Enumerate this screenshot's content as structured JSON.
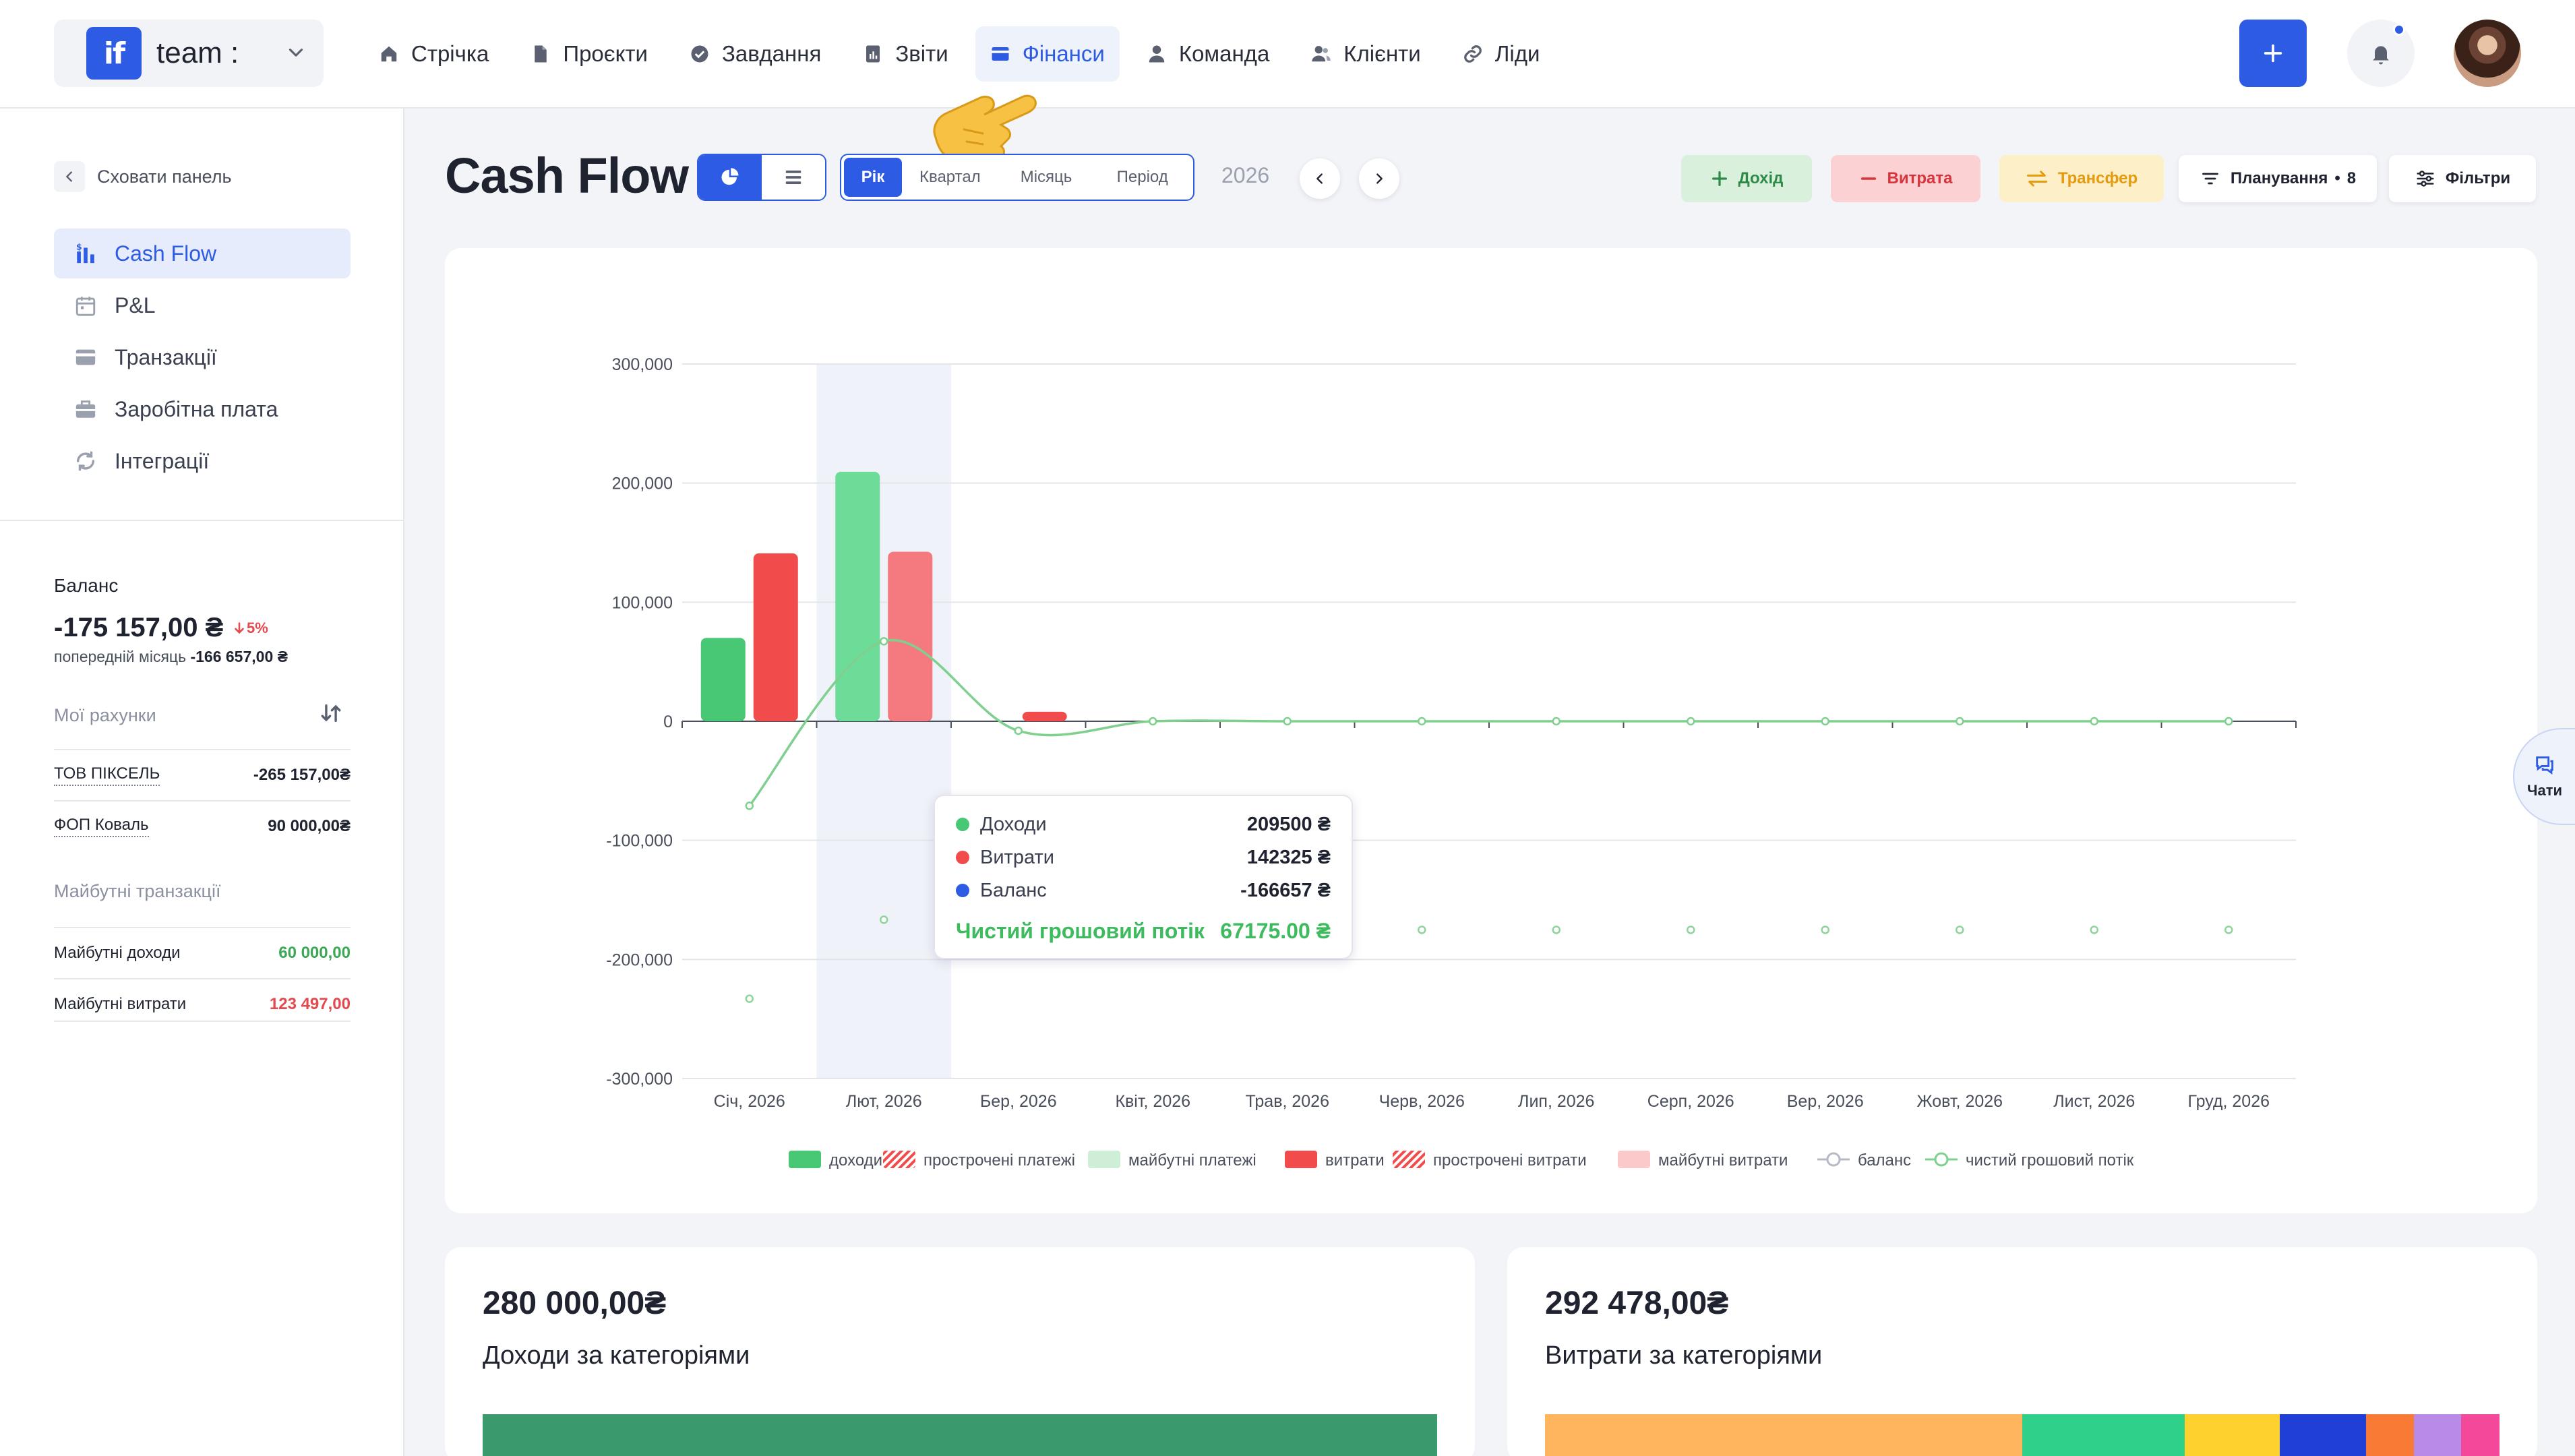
{
  "brand": {
    "logo": "if",
    "name": "team :"
  },
  "nav": [
    {
      "label": "Стрічка",
      "icon": "home-icon"
    },
    {
      "label": "Проєкти",
      "icon": "file-icon"
    },
    {
      "label": "Завдання",
      "icon": "check-circle-icon"
    },
    {
      "label": "Звіти",
      "icon": "report-icon"
    },
    {
      "label": "Фінанси",
      "icon": "wallet-icon",
      "active": true
    },
    {
      "label": "Команда",
      "icon": "user-icon"
    },
    {
      "label": "Клієнти",
      "icon": "users-icon"
    },
    {
      "label": "Ліди",
      "icon": "link-icon"
    }
  ],
  "sidebar": {
    "hide_label": "Сховати панель",
    "menu": [
      {
        "label": "Cash Flow",
        "icon": "bar-dollar-icon",
        "active": true
      },
      {
        "label": "P&L",
        "icon": "calendar-icon"
      },
      {
        "label": "Транзакції",
        "icon": "card-icon"
      },
      {
        "label": "Заробітна плата",
        "icon": "briefcase-icon"
      },
      {
        "label": "Інтеграції",
        "icon": "refresh-icon"
      }
    ],
    "balance": {
      "title": "Баланс",
      "value": "-175 157,00 ₴",
      "change": "5%",
      "prev_label": "попередній місяць",
      "prev_value": "-166 657,00 ₴"
    },
    "accounts_label": "Мої рахунки",
    "accounts": [
      {
        "name": "ТОВ ПІКСЕЛЬ",
        "value": "-265 157,00₴"
      },
      {
        "name": "ФОП Коваль",
        "value": "90 000,00₴"
      }
    ],
    "future_label": "Майбутні транзакції",
    "future": [
      {
        "name": "Майбутні доходи",
        "value": "60 000,00"
      },
      {
        "name": "Майбутні витрати",
        "value": "123 497,00"
      }
    ]
  },
  "header": {
    "title": "Cash Flow",
    "periods": [
      "Рік",
      "Квартал",
      "Місяць",
      "Період"
    ],
    "active_period": "Рік",
    "year": "2026",
    "income_btn": "Дохід",
    "expense_btn": "Витрата",
    "transfer_btn": "Трансфер",
    "planning_btn": "Планування",
    "planning_count": "8",
    "filters_btn": "Фільтри"
  },
  "chart_data": {
    "type": "bar",
    "categories": [
      "Січ, 2026",
      "Лют, 2026",
      "Бер, 2026",
      "Квіт, 2026",
      "Трав, 2026",
      "Черв, 2026",
      "Лип, 2026",
      "Серп, 2026",
      "Вер, 2026",
      "Жовт, 2026",
      "Лист, 2026",
      "Груд, 2026"
    ],
    "ylim": [
      -300000,
      300000
    ],
    "yticks": [
      -300000,
      -200000,
      -100000,
      0,
      100000,
      200000,
      300000
    ],
    "ytick_labels": [
      "-300,000",
      "-200,000",
      "-100,000",
      "0",
      "100,000",
      "200,000",
      "300,000"
    ],
    "grid": true,
    "series": [
      {
        "name": "доходи",
        "kind": "bar",
        "color": "#48c774",
        "values": [
          70000,
          209500,
          0,
          0,
          0,
          0,
          0,
          0,
          0,
          0,
          0,
          0
        ]
      },
      {
        "name": "витрати",
        "kind": "bar",
        "color": "#f24b4b",
        "values": [
          141000,
          142325,
          8000,
          0,
          0,
          0,
          0,
          0,
          0,
          0,
          0,
          0
        ]
      },
      {
        "name": "баланс",
        "kind": "points",
        "color": "#8fd49b",
        "values": [
          -233000,
          -166657,
          null,
          null,
          -175157,
          -175157,
          -175157,
          -175157,
          -175157,
          -175157,
          -175157,
          -175157
        ]
      },
      {
        "name": "чистий грошовий потік",
        "kind": "line",
        "color": "#7fd08e",
        "values": [
          -71000,
          67175,
          -8000,
          0,
          0,
          0,
          0,
          0,
          0,
          0,
          0,
          0
        ]
      }
    ],
    "legend": [
      {
        "label": "доходи",
        "swatch": "solid",
        "color": "#48c774"
      },
      {
        "label": "прострочені платежі",
        "swatch": "hatch",
        "color": "#f24b4b"
      },
      {
        "label": "майбутні платежі",
        "swatch": "solid",
        "color": "#cfeed8"
      },
      {
        "label": "витрати",
        "swatch": "solid",
        "color": "#f24b4b"
      },
      {
        "label": "прострочені витрати",
        "swatch": "hatch",
        "color": "#f24b4b"
      },
      {
        "label": "майбутні витрати",
        "swatch": "solid",
        "color": "#fcc9cb"
      },
      {
        "label": "баланс",
        "swatch": "line",
        "color": "#b5b9c4"
      },
      {
        "label": "чистий грошовий потік",
        "swatch": "line",
        "color": "#7fd08e"
      }
    ],
    "legend_position": "bottom",
    "highlight_category": "Лют, 2026",
    "tooltip": {
      "rows": [
        {
          "label": "Доходи",
          "value": "209500 ₴",
          "color": "#48c774"
        },
        {
          "label": "Витрати",
          "value": "142325 ₴",
          "color": "#f24b4b"
        },
        {
          "label": "Баланс",
          "value": "-166657 ₴",
          "color": "#2d5be3"
        }
      ],
      "net_label": "Чистий грошовий потік",
      "net_value": "67175.00 ₴"
    }
  },
  "chats_label": "Чати",
  "income_card": {
    "amount": "280 000,00₴",
    "title": "Доходи за категоріями",
    "segments": [
      {
        "color": "#3a9a6e",
        "share": 1.0
      }
    ]
  },
  "expense_card": {
    "amount": "292 478,00₴",
    "title": "Витрати за категоріями",
    "segments": [
      {
        "color": "#ffb55e",
        "share": 0.5
      },
      {
        "color": "#2fd18a",
        "share": 0.17
      },
      {
        "color": "#ffd12e",
        "share": 0.1
      },
      {
        "color": "#1f3fd6",
        "share": 0.09
      },
      {
        "color": "#f97a34",
        "share": 0.05
      },
      {
        "color": "#b98ae8",
        "share": 0.05
      },
      {
        "color": "#f4499b",
        "share": 0.04
      }
    ]
  },
  "colors": {
    "accent": "#2d5be3",
    "income": "#48c774",
    "expense": "#f24b4b",
    "transfer": "#f0a020"
  }
}
